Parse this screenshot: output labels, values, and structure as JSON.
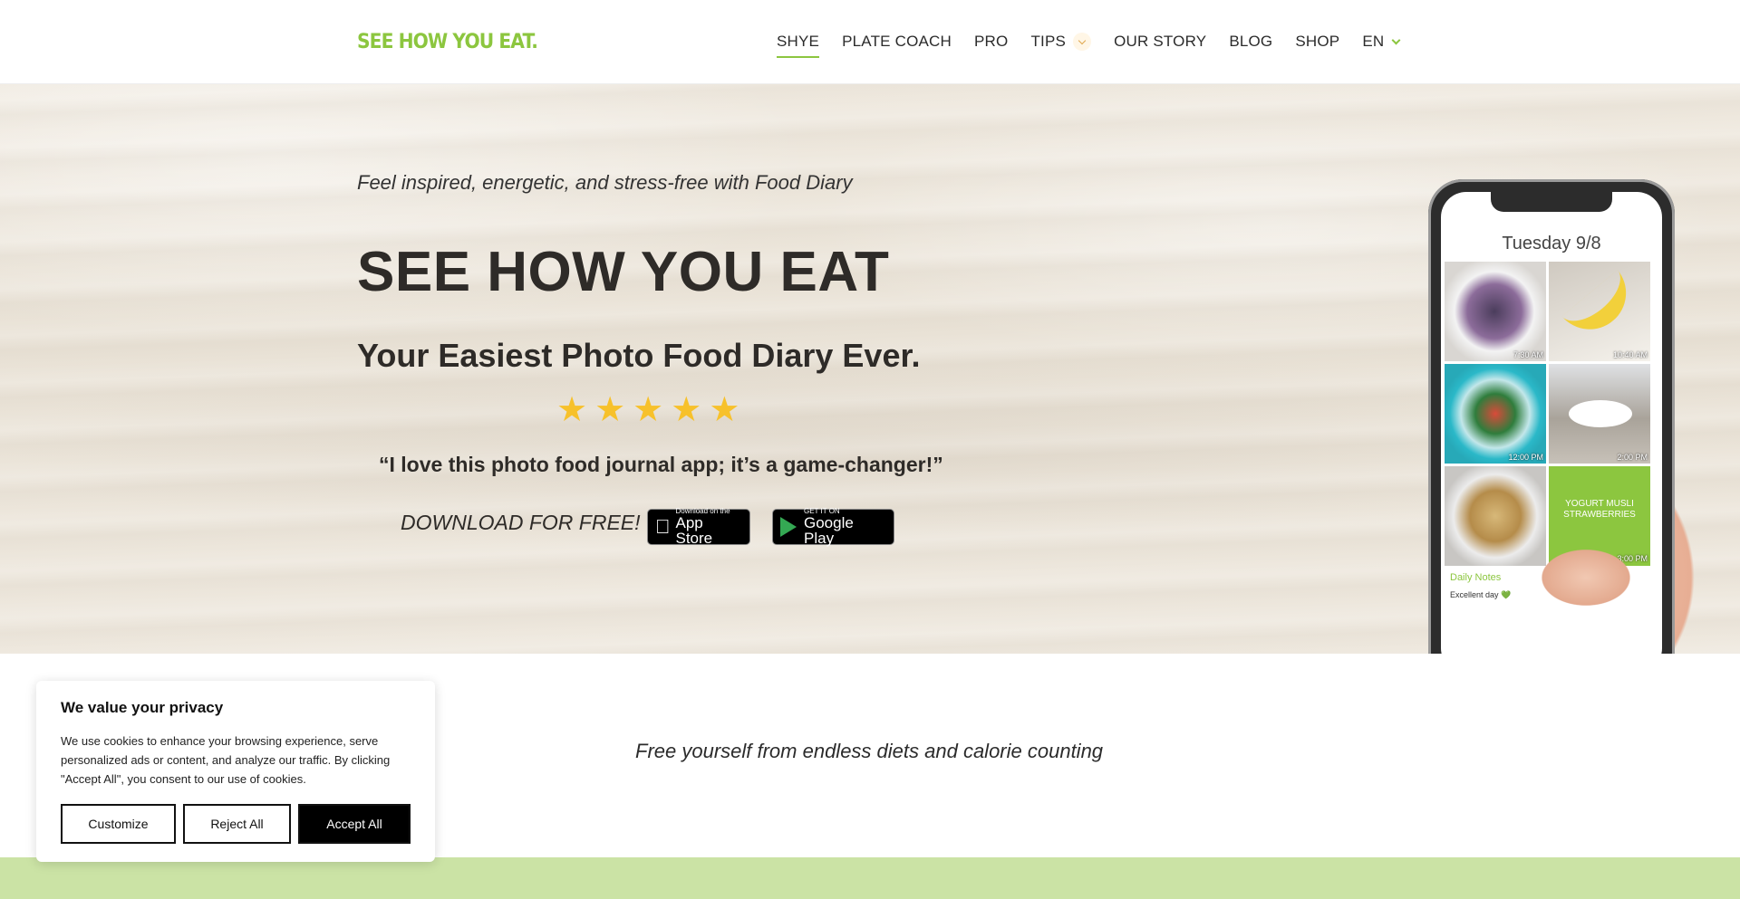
{
  "header": {
    "logo": "SEE HOW YOU EAT.",
    "nav": [
      {
        "label": "SHYE",
        "active": true
      },
      {
        "label": "PLATE COACH"
      },
      {
        "label": "PRO"
      },
      {
        "label": "TIPS"
      },
      {
        "label": "OUR STORY"
      },
      {
        "label": "BLOG"
      },
      {
        "label": "SHOP"
      },
      {
        "label": "EN"
      }
    ]
  },
  "hero": {
    "tagline": "Feel inspired, energetic, and stress-free with Food Diary",
    "title": "SEE HOW YOU EAT",
    "subtitle": "Your Easiest Photo Food Diary Ever.",
    "rating_stars": 5,
    "quote": "“I love this photo food journal app; it’s a game-changer!”",
    "download_label": "DOWNLOAD FOR FREE!",
    "app_store": {
      "small": "Download on the",
      "big": "App Store"
    },
    "google_play": {
      "small": "GET IT ON",
      "big": "Google Play"
    }
  },
  "phone": {
    "date": "Tuesday 9/8",
    "tiles": [
      {
        "time": "7:30 AM"
      },
      {
        "time": "10:40 AM"
      },
      {
        "time": "12:00 PM"
      },
      {
        "time": "2:00 PM"
      },
      {
        "time": ""
      },
      {
        "time": "3:00 PM",
        "text": "YOGURT MUSLI STRAWBERRIES"
      }
    ],
    "notes_title": "Daily Notes",
    "notes_text": "Excellent day 💚"
  },
  "section2": {
    "text": "Free yourself from endless diets and calorie counting"
  },
  "cookie": {
    "title": "We value your privacy",
    "text": "We use cookies to enhance your browsing experience, serve personalized ads or content, and analyze our traffic. By clicking \"Accept All\", you consent to our use of cookies.",
    "customize": "Customize",
    "reject": "Reject All",
    "accept": "Accept All"
  },
  "colors": {
    "brand_green": "#8cc63f",
    "star_yellow": "#f7c12b",
    "band_green": "#cbe3a5"
  }
}
